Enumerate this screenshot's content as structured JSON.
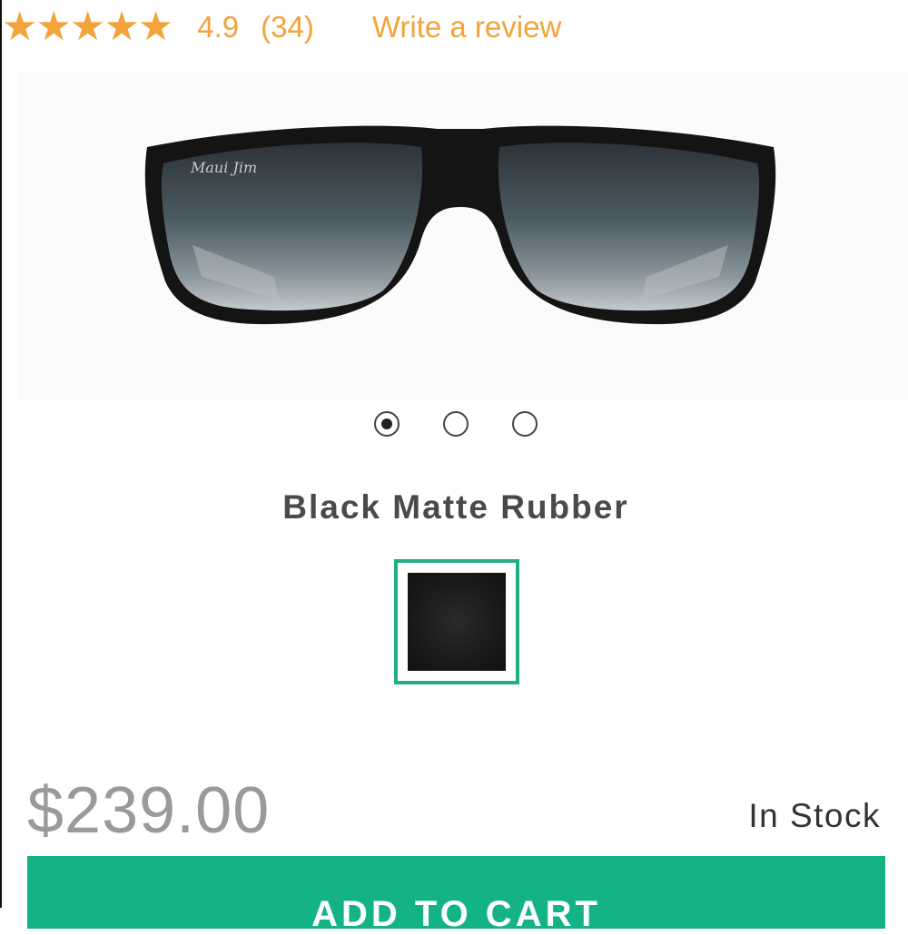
{
  "rating": {
    "stars": "★★★★★",
    "score": "4.9",
    "count": "(34)",
    "write_review": "Write a review"
  },
  "carousel": {
    "active_index": 0,
    "dot_count": 3
  },
  "product": {
    "color_name": "Black Matte Rubber",
    "price": "$239.00",
    "stock_status": "In Stock",
    "cta_label": "ADD TO CART"
  },
  "colors": {
    "star": "#f2a33a",
    "accent": "#14b387",
    "swatch_border": "#1fae85",
    "price": "#9a9a9a"
  },
  "icons": {
    "star": "star-icon",
    "carousel_dot": "carousel-dot-icon"
  }
}
